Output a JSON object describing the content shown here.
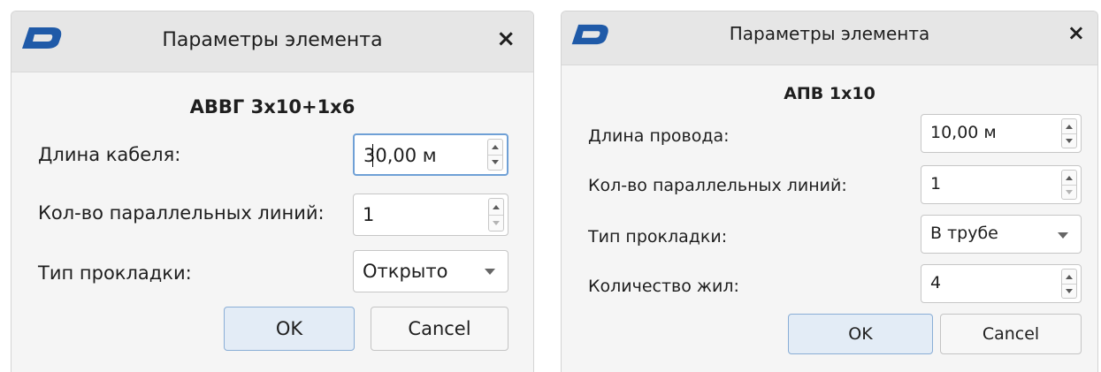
{
  "brand": {
    "accent": "#1f5aa8",
    "logo_icon": "app-logo-icon"
  },
  "dialog1": {
    "title": "Параметры элемента",
    "close": "×",
    "element_name": "АВВГ 3х10+1х6",
    "rows": [
      {
        "label": "Длина кабеля:",
        "value": "30,00 м",
        "control": "spinbox"
      },
      {
        "label": "Кол-во параллельных линий:",
        "value": "1",
        "control": "spinbox"
      },
      {
        "label": "Тип прокладки:",
        "value": "Открыто",
        "control": "combobox"
      }
    ],
    "ok_label": "OK",
    "cancel_label": "Cancel"
  },
  "dialog2": {
    "title": "Параметры элемента",
    "close": "×",
    "element_name": "АПВ 1х10",
    "rows": [
      {
        "label": "Длина провода:",
        "value": "10,00 м",
        "control": "spinbox"
      },
      {
        "label": "Кол-во параллельных линий:",
        "value": "1",
        "control": "spinbox"
      },
      {
        "label": "Тип прокладки:",
        "value": "В трубе",
        "control": "combobox"
      },
      {
        "label": "Количество жил:",
        "value": "4",
        "control": "spinbox"
      }
    ],
    "ok_label": "OK",
    "cancel_label": "Cancel"
  }
}
